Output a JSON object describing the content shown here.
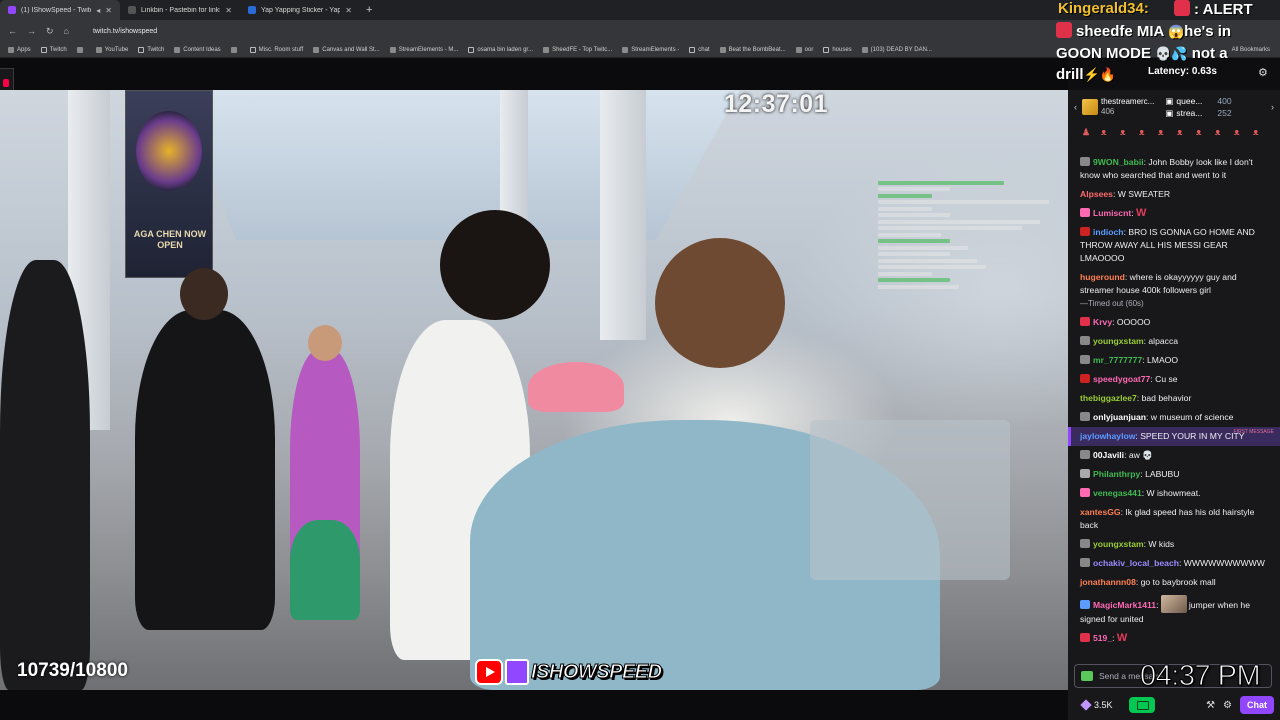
{
  "browser": {
    "tabs": [
      {
        "label": "(1) IShowSpeed - Twitch",
        "color": "#9146ff",
        "active": true
      },
      {
        "label": "Linkbin - Pastebin for links",
        "color": "#3a3a3a",
        "active": false
      },
      {
        "label": "Yap Yapping Sticker - Yap Yappi...",
        "color": "#2a6bd6",
        "active": false
      }
    ],
    "url": "twitch.tv/ishowspeed",
    "bookmarks": [
      {
        "label": "Apps"
      },
      {
        "label": "Twitch"
      },
      {
        "label": ""
      },
      {
        "label": "YouTube"
      },
      {
        "label": "Twitch"
      },
      {
        "label": "Content Ideas"
      },
      {
        "label": ""
      },
      {
        "label": "Misc. Room stuff"
      },
      {
        "label": "Canvas and Wall St..."
      },
      {
        "label": "StreamElements - M..."
      },
      {
        "label": "osama bin laden gr..."
      },
      {
        "label": "SheedFE - Top Twitc..."
      },
      {
        "label": "StreamElements -"
      },
      {
        "label": "chat"
      },
      {
        "label": "Beat the BombBeat..."
      },
      {
        "label": "oor"
      },
      {
        "label": "houses"
      },
      {
        "label": "(103) DEAD BY DAN..."
      }
    ],
    "all_bookmarks": "All Bookmarks"
  },
  "video": {
    "stream_timer": "12:37:01",
    "sub_counter": "10739/10800",
    "brand": "ISHOWSPEED",
    "banner_text": "AGA CHEN NOW OPEN"
  },
  "alert": {
    "name": "Kingerald34:",
    "header": ": ALERT",
    "line2": "sheedfe MIA",
    "line2b": "he's in",
    "line3": "GOON MODE",
    "line3b": "not a",
    "line4": "drill"
  },
  "latency": "Latency: 0.63s",
  "gift_bar": {
    "user": "thestreamerc...",
    "user_count": "406",
    "items": [
      {
        "name": "quee...",
        "count": "400"
      },
      {
        "name": "strea...",
        "count": "252"
      }
    ]
  },
  "chat": {
    "messages": [
      {
        "user": "9WON_babii",
        "color": "#3fb950",
        "text": "John Bobby look like I don't know who searched that and went to it",
        "badge": "#888"
      },
      {
        "user": "Alpsees",
        "color": "#ff6b6b",
        "text": "W SWEATER",
        "badge": ""
      },
      {
        "user": "Lumiscnt",
        "color": "#ff69b4",
        "text": "",
        "emote": "W",
        "badge": "#ff69b4"
      },
      {
        "user": "indioch",
        "color": "#5b9cff",
        "text": "BRO IS GONNA GO HOME AND THROW AWAY ALL HIS MESSI GEAR LMAOOOO",
        "badge": "#cc2222"
      },
      {
        "user": "hugeround",
        "color": "#ff7f50",
        "text": "where is okayyyyyy guy and streamer house 400k followers girl",
        "timeout": "—Timed out (60s)",
        "badge": ""
      },
      {
        "user": "Krvy",
        "color": "#ff69b4",
        "text": "OOOOO",
        "badge": "#e0304a"
      },
      {
        "user": "youngxstam",
        "color": "#9acd32",
        "text": "alpacca",
        "badge": "#888"
      },
      {
        "user": "mr_7777777",
        "color": "#3fb950",
        "text": "LMAOO",
        "badge": "#888"
      },
      {
        "user": "speedygoat77",
        "color": "#ff69b4",
        "text": "Cu se",
        "badge": "#cc2222"
      },
      {
        "user": "thebiggazlee7",
        "color": "#9acd32",
        "text": "bad behavior",
        "badge": ""
      },
      {
        "user": "onlyjuanjuan",
        "color": "#ffffff",
        "text": "w museum of science",
        "badge": "#888"
      },
      {
        "user": "jaylowhaylow",
        "color": "#5b9cff",
        "text": "SPEED YOUR IN MY CITY",
        "highlight": true,
        "tag": "FIRST MESSAGE",
        "badge": ""
      },
      {
        "user": "00Javili",
        "color": "#ffffff",
        "text": "aw 💀",
        "badge": "#888"
      },
      {
        "user": "Philanthrpy",
        "color": "#3fb950",
        "text": "LABUBU",
        "badge": "#aaa"
      },
      {
        "user": "venegas441",
        "color": "#3fb950",
        "text": "W ishowmeat.",
        "badge": "#ff69b4"
      },
      {
        "user": "xantesGG",
        "color": "#ff7f50",
        "text": "Ik glad speed has his old hairstyle back",
        "badge": ""
      },
      {
        "user": "youngxstam",
        "color": "#9acd32",
        "text": "W kids",
        "badge": "#888"
      },
      {
        "user": "ochakiv_local_beach",
        "color": "#9a8cff",
        "text": "WWWWWWWWWW",
        "badge": "#888"
      },
      {
        "user": "jonathannn08",
        "color": "#ff7f50",
        "text": "go to baybrook mall",
        "badge": ""
      },
      {
        "user": "MagicMark1411",
        "color": "#ff69b4",
        "text": "jumper when he signed for united",
        "avatar": true,
        "badge": "#5b9cff"
      },
      {
        "user": "519_",
        "color": "#ff69b4",
        "text": "",
        "emote": "W",
        "badge": "#e0304a"
      }
    ],
    "input_placeholder": "Send a message",
    "clock": "04:37 PM",
    "points": "3.5K",
    "chat_button": "Chat"
  }
}
